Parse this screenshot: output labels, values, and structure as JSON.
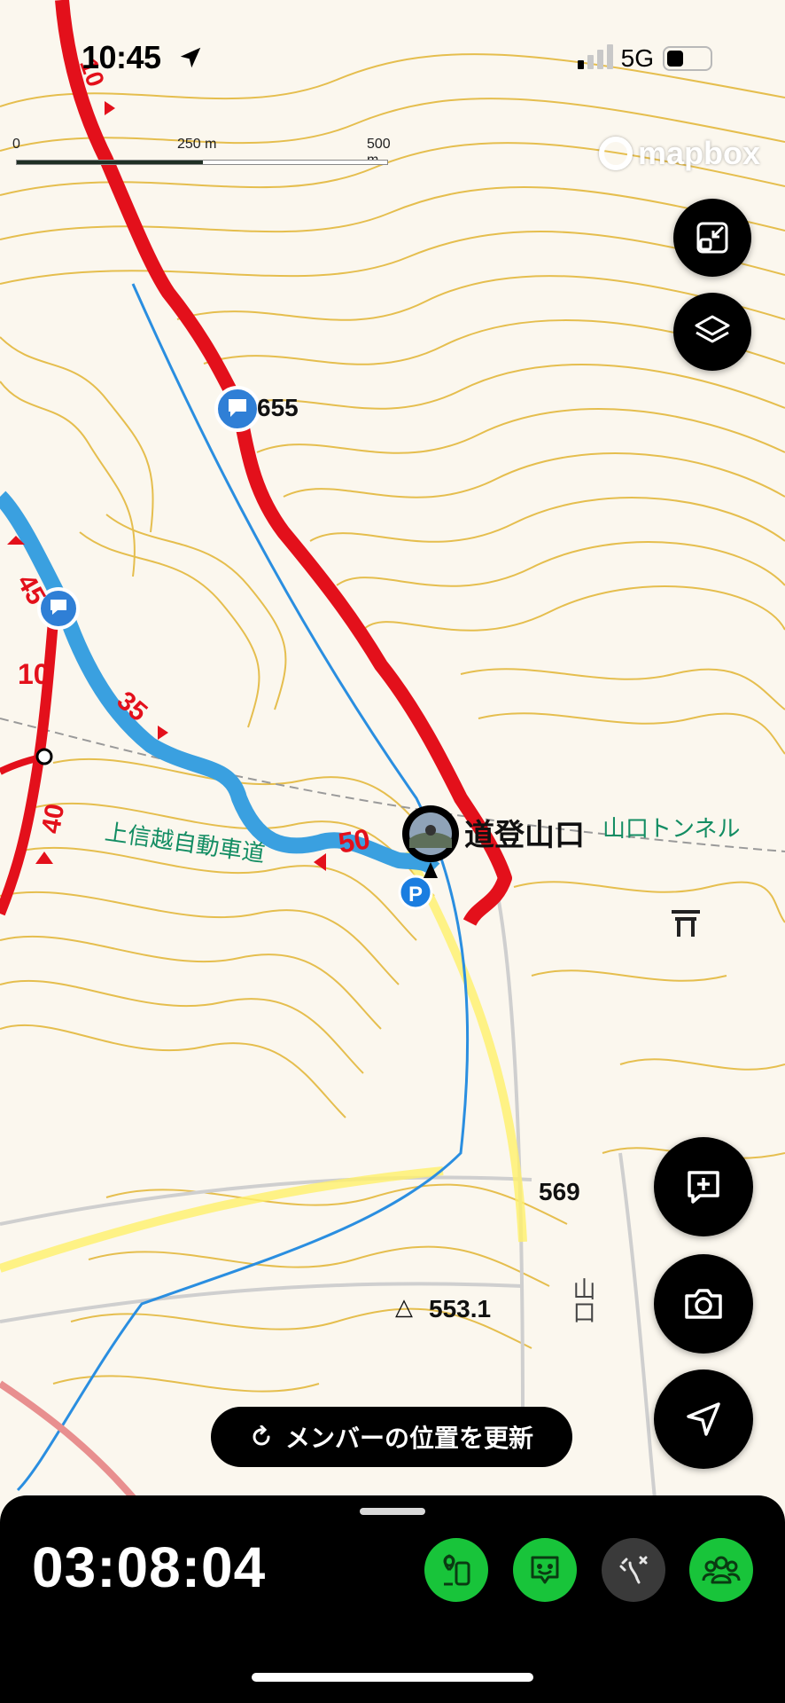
{
  "status_bar": {
    "time": "10:45",
    "network": "5G"
  },
  "scale": {
    "labels": [
      "0",
      "250 m",
      "500 m"
    ]
  },
  "attribution": {
    "logo_text": "mapbox"
  },
  "map": {
    "labels": {
      "waypoint_elev": "655",
      "trailhead": "道登山口",
      "highway": "上信越自動車道",
      "tunnel": "山口トンネル",
      "spot_569": "569",
      "triangulation": "553.1",
      "place_yamaguchi": "山口"
    },
    "contour_marks": [
      "10",
      "45",
      "10",
      "35",
      "40",
      "50",
      "10"
    ],
    "colors": {
      "route_red": "#e3101b",
      "route_blue": "#3aa0e0",
      "contour": "#e3b83d",
      "trail_highlight": "#fff06a"
    }
  },
  "controls": {
    "zoom_fit_icon": "minimize-icon",
    "layers_icon": "layers-icon",
    "add_marker_icon": "add-note-icon",
    "camera_icon": "camera-icon",
    "locate_icon": "navigation-icon"
  },
  "refresh_button": {
    "label": "メンバーの位置を更新",
    "icon": "refresh-icon"
  },
  "bottom_panel": {
    "elapsed": "03:08:04",
    "buttons": [
      {
        "icon": "route-icon",
        "color": "#18c43a"
      },
      {
        "icon": "message-icon",
        "color": "#18c43a"
      },
      {
        "icon": "route-off-icon",
        "color": "#3a3a3a"
      },
      {
        "icon": "group-icon",
        "color": "#18c43a"
      }
    ]
  }
}
